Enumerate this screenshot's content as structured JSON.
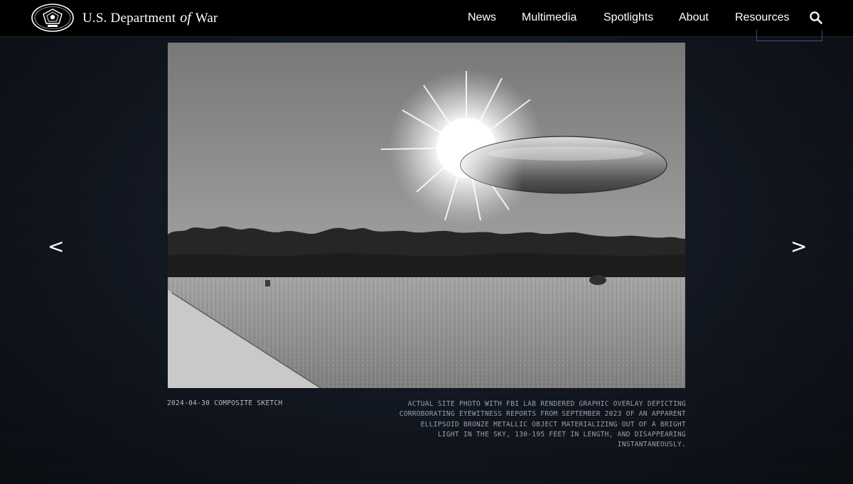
{
  "header": {
    "brand": {
      "part1": "U.S. Department",
      "part2": "of",
      "part3": "War"
    },
    "nav": [
      {
        "label": "News"
      },
      {
        "label": "Multimedia"
      },
      {
        "label": "Spotlights"
      },
      {
        "label": "About"
      },
      {
        "label": "Resources"
      }
    ],
    "search_icon": "search-icon",
    "logo_icon": "pentagon-seal-icon"
  },
  "gallery": {
    "prev_label": "<",
    "next_label": ">",
    "caption_left": "2024-04-30 COMPOSITE SKETCH",
    "caption_right": "ACTUAL SITE PHOTO WITH FBI LAB RENDERED GRAPHIC OVERLAY DEPICTING CORROBORATING EYEWITNESS REPORTS FROM SEPTEMBER 2023 OF AN APPARENT ELLIPSOID BRONZE METALLIC OBJECT MATERIALIZING OUT OF A BRIGHT LIGHT IN THE SKY, 130-195 FEET IN LENGTH, AND DISAPPEARING INSTANTANEOUSLY."
  },
  "colors": {
    "header_bg": "#000000",
    "page_bg": "#0e131c",
    "caption_text": "#9aa0aa"
  }
}
